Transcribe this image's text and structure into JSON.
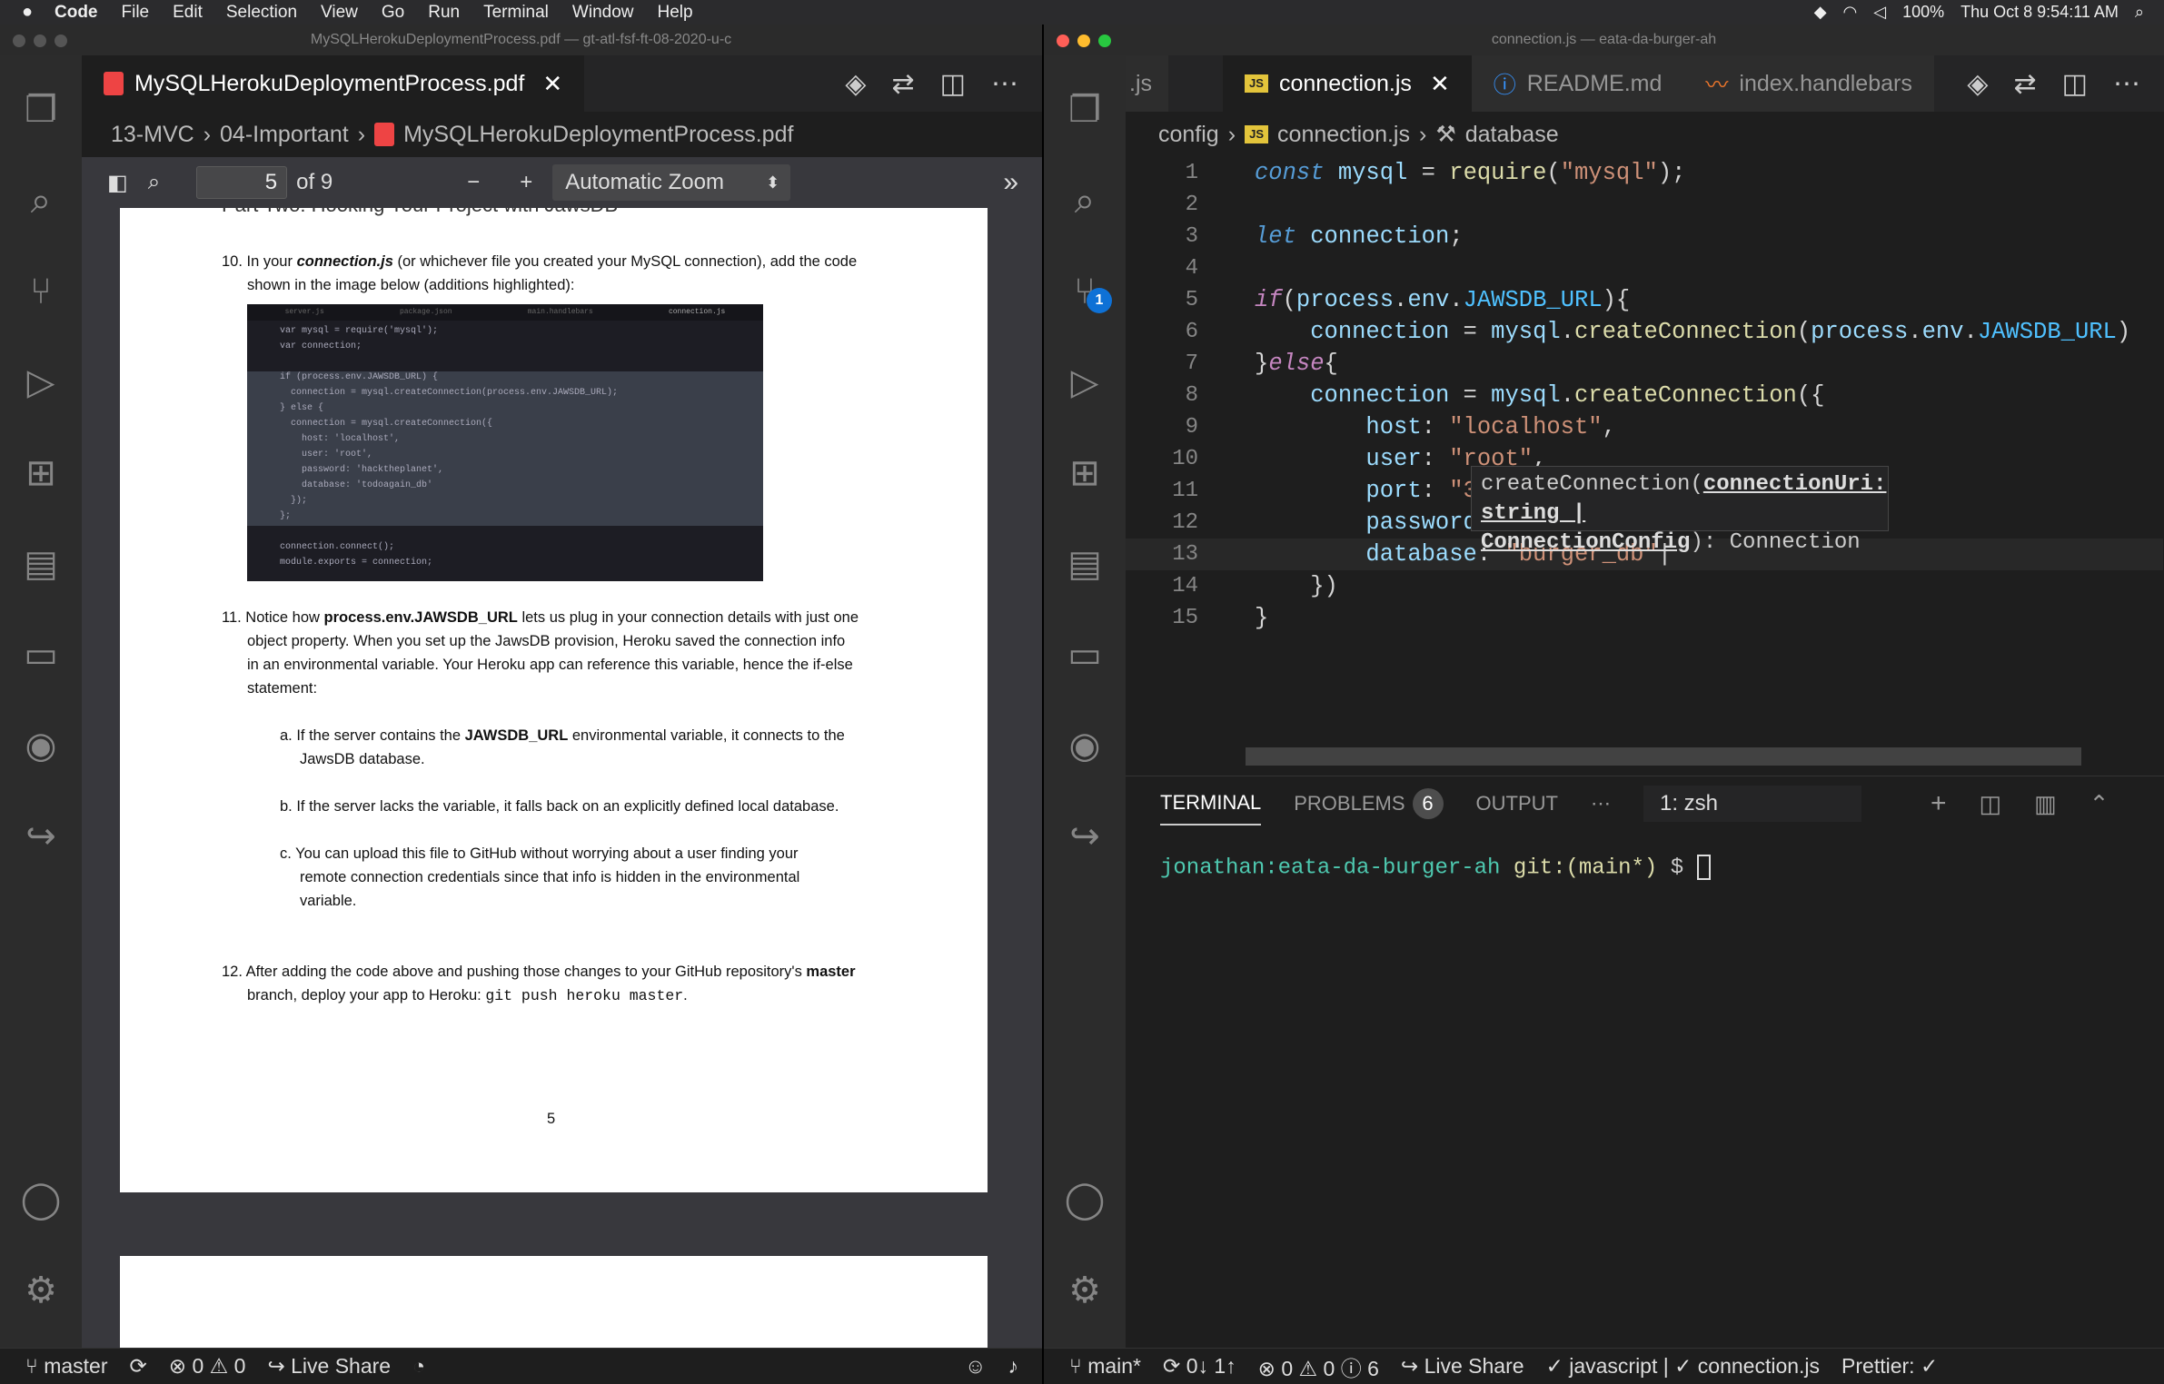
{
  "menubar": {
    "app": "Code",
    "items": [
      "File",
      "Edit",
      "Selection",
      "View",
      "Go",
      "Run",
      "Terminal",
      "Window",
      "Help"
    ],
    "battery": "100%",
    "datetime": "Thu Oct 8  9:54:11 AM"
  },
  "left": {
    "window_title": "MySQLHerokuDeploymentProcess.pdf — gt-atl-fsf-ft-08-2020-u-c",
    "tab": "MySQLHerokuDeploymentProcess.pdf",
    "crumb": [
      "13-MVC",
      "04-Important",
      "MySQLHerokuDeploymentProcess.pdf"
    ],
    "pdf": {
      "page": "5",
      "of": "of 9",
      "zoom": "Automatic Zoom",
      "page_number": "5",
      "heading": "Part Two: Hooking Your Project with JawsDB",
      "p10a": "10. In your ",
      "p10b": "connection.js",
      "p10c": " (or whichever file you created your MySQL connection), add the code",
      "p10d": "shown in the image below (additions highlighted):",
      "img_tabs": [
        "server.js",
        "package.json",
        "main.handlebars",
        "connection.js"
      ],
      "img_code": [
        "var mysql = require('mysql');",
        "var connection;",
        "",
        "if (process.env.JAWSDB_URL) {",
        "  connection = mysql.createConnection(process.env.JAWSDB_URL);",
        "} else {",
        "  connection = mysql.createConnection({",
        "    host: 'localhost',",
        "    user: 'root',",
        "    password: 'hacktheplanet',",
        "    database: 'todoagain_db'",
        "  });",
        "};",
        "",
        "connection.connect();",
        "module.exports = connection;"
      ],
      "p11a": "11. Notice how ",
      "p11b": "process.env.JAWSDB_URL",
      "p11c": " lets us plug in your connection details with just one",
      "p11d": "object property. When you set up the JawsDB provision, Heroku saved the connection info",
      "p11e": "in an environmental variable. Your Heroku app can reference this variable, hence the if-else",
      "p11f": "statement:",
      "pa1": "a.  If the server contains the ",
      "pa2": "JAWSDB_URL",
      "pa3": " environmental variable, it connects to the",
      "pa4": "JawsDB database.",
      "pb": "b.  If the server lacks the variable, it falls back on an explicitly defined local database.",
      "pc1": "c.  You can upload this file to GitHub without worrying about a user finding your",
      "pc2": "remote connection credentials since that info is hidden in the environmental",
      "pc3": "variable.",
      "p12a": "12. After adding the code above and pushing those changes to your GitHub repository's ",
      "p12b": "master",
      "p12c": "branch, deploy your app to Heroku: ",
      "p12d": "git push heroku master",
      "p12e": "."
    },
    "status": {
      "branch": "master",
      "errors": "0",
      "warnings": "0",
      "liveshare": "Live Share"
    }
  },
  "right": {
    "window_title": "connection.js — eata-da-burger-ah",
    "tabs": [
      ".js",
      "connection.js",
      "README.md",
      "index.handlebars"
    ],
    "crumb": [
      "config",
      "connection.js",
      "database"
    ],
    "tooltip": {
      "fn": "createConnection(",
      "param": "connectionUri: string |",
      "type": "ConnectionConfig",
      "ret": "): Connection"
    },
    "panel": {
      "tabs": [
        "TERMINAL",
        "PROBLEMS",
        "OUTPUT"
      ],
      "problems": "6",
      "shell": "1: zsh",
      "prompt_user": "jonathan:eata-da-burger-ah",
      "prompt_git": "git:(main*)",
      "prompt_sym": "$"
    },
    "status": {
      "branch": "main*",
      "sync": "0↓ 1↑",
      "errors": "0",
      "warnings": "0",
      "info": "6",
      "liveshare": "Live Share",
      "lang": "✓ javascript | ✓ connection.js",
      "prettier": "Prettier: ✓"
    }
  }
}
